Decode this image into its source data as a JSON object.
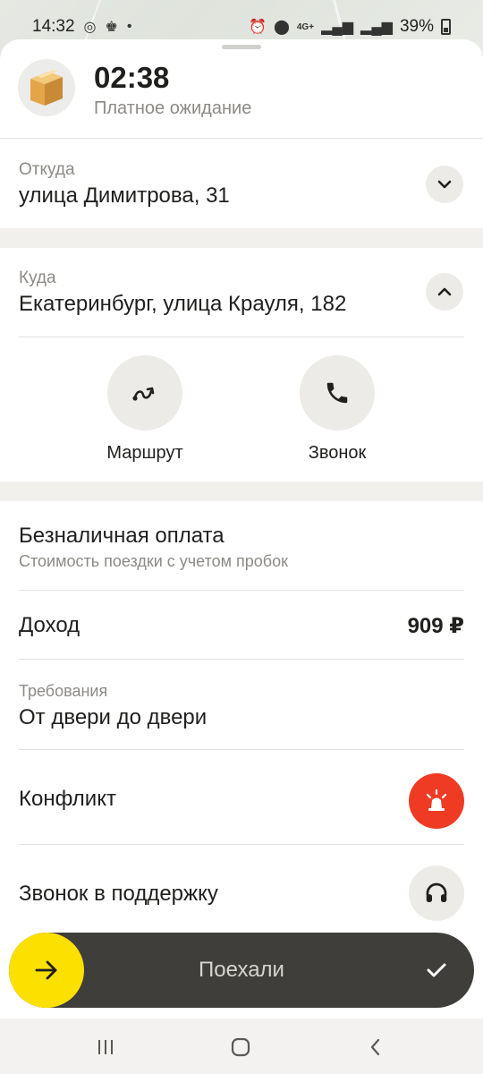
{
  "status_bar": {
    "time": "14:32",
    "network": "4G+",
    "battery": "39%"
  },
  "order": {
    "timer": "02:38",
    "timer_caption": "Платное ожидание"
  },
  "from": {
    "label": "Откуда",
    "address": "улица Димитрова, 31"
  },
  "to": {
    "label": "Куда",
    "address": "Екатеринбург, улица Крауля, 182"
  },
  "actions": {
    "route_label": "Маршрут",
    "call_label": "Звонок"
  },
  "payment": {
    "title": "Безналичная оплата",
    "subtitle": "Стоимость поездки с учетом пробок"
  },
  "income": {
    "label": "Доход",
    "value": "909 ₽"
  },
  "requirements": {
    "label": "Требования",
    "value": "От двери до двери"
  },
  "conflict": {
    "label": "Конфликт"
  },
  "support": {
    "label": "Звонок в поддержку"
  },
  "slider": {
    "label": "Поехали"
  },
  "colors": {
    "accent_yellow": "#fce000",
    "conflict_red": "#ef3b24",
    "slider_dark": "#3f3e3b"
  }
}
